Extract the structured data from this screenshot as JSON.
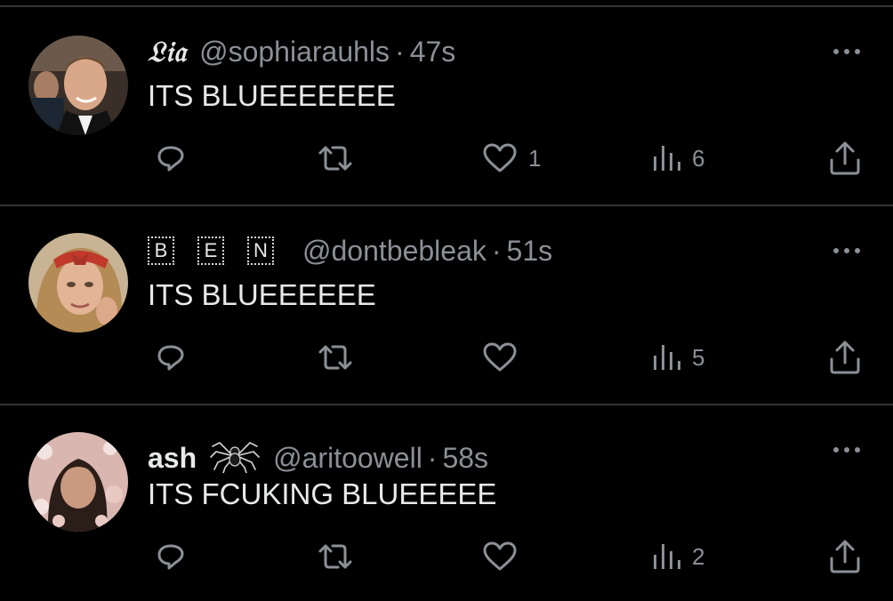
{
  "tweets": [
    {
      "display_name": "𝔏𝔦𝔞",
      "handle": "@sophiarauhls",
      "separator": "·",
      "time": "47s",
      "text": "ITS BLUEEEEEEE",
      "likes": "1",
      "views": "6",
      "avatar_icon": "profile-photo"
    },
    {
      "display_name_letters": [
        "B",
        "E",
        "N"
      ],
      "handle": "@dontbebleak",
      "separator": "·",
      "time": "51s",
      "text": "ITS BLUEEEEEE",
      "likes": "",
      "views": "5",
      "avatar_icon": "profile-photo"
    },
    {
      "display_name": "ash",
      "name_emoji": "spider-icon",
      "handle": "@aritoowell",
      "separator": "·",
      "time": "58s",
      "text": "ITS FCUKING BLUEEEEE",
      "likes": "",
      "views": "2",
      "avatar_icon": "profile-photo"
    }
  ],
  "colors": {
    "background": "#000000",
    "text": "#e7e9ea",
    "secondary": "#8b9096",
    "divider": "#2f3336"
  }
}
